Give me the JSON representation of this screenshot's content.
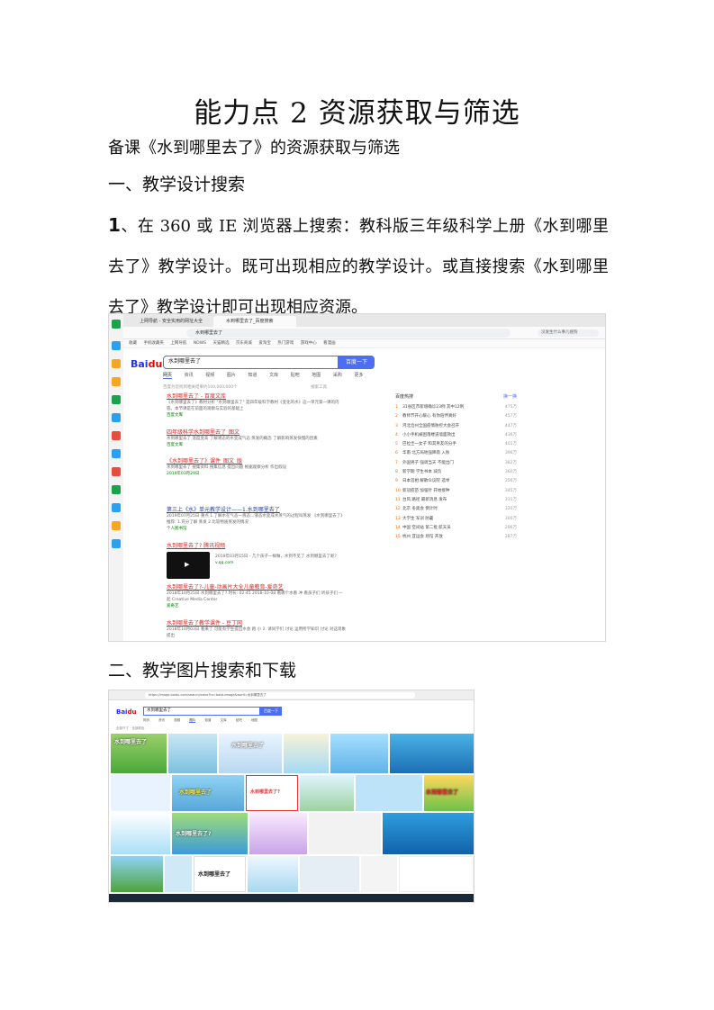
{
  "document": {
    "title": "能力点 2 资源获取与筛选",
    "subtitle": "备课《水到哪里去了》的资源获取与筛选",
    "section1_heading": "一、教学设计搜索",
    "step_number": "1",
    "step_text": "、在 360 或 IE 浏览器上搜索：教科版三年级科学上册《水到哪里去了》教学设计。既可出现相应的教学设计。或直接搜索《水到哪里去了》教学设计即可出现相应资源。",
    "section2_heading": "二、教学图片搜索和下载"
  },
  "screenshot1": {
    "tabs": [
      "上网导航 - 安全实用的网址大全",
      "水到哪里去了_百度搜索"
    ],
    "address": "水到哪里去了",
    "search_hint": "没发生什么事儿搜狗",
    "bookmarks": [
      "收藏",
      "手机收藏夹",
      "上网导航",
      "NOWS",
      "天猫精选",
      "京东商城",
      "爱淘宝",
      "热门游戏",
      "游戏中心",
      "看漫画"
    ],
    "search_query": "水到哪里去了",
    "search_button": "百度一下",
    "nav_tabs": [
      "网页",
      "资讯",
      "视频",
      "图片",
      "知道",
      "文库",
      "贴吧",
      "地图",
      "采购",
      "更多"
    ],
    "result_meta": "百度为您找到相关结果约100,000,000个",
    "search_tools": "搜索工具",
    "results": [
      {
        "title": "水到哪里去了 - 百度文库",
        "desc": "《水到哪里去了》教材分析 \"水到哪里去了\" 是四年级科学教材《变化的水》这一单元第一课的内容。本节课是在前面的观察与实验的基础上",
        "source": "百度文库"
      },
      {
        "title": "四年级科学水到哪里去了_图文",
        "desc": "水到哪里去了 温度变高 了解液态的水变成气态 蒸发的概念 了解影响蒸发快慢的因素",
        "source": "百度文库"
      },
      {
        "title": "《水到哪里去了》课件_图文_版",
        "desc": "水到哪里去了 搜集资料 搜集信息 提出问题 根据观察分析 作出假设",
        "source": "2019年03月29日"
      },
      {
        "title": "第三上《水》单元教学设计——1.水到哪里去了",
        "desc": "2019年07月25日 重点 1.了解水在气态一液态...液态水变成水蒸气的过程叫蒸发 《水到哪里去了》 推荐: 1.充分了解 蒸发 2.比较物质蒸发的情况",
        "source": "个人图书馆"
      },
      {
        "title": "水到哪里去了? 腾讯视频",
        "desc": "2019年03月15日 - 几个孩子一样做，水到不见了 水到哪里去了呢?",
        "source": "v.qq.com"
      },
      {
        "title": "水到哪里去了?-儿童-动画片大全儿童教育-爱奇艺",
        "desc": "2018年10月25日 水到哪里去了? 时长: 02:45 2018-10-08 看哪个水看 冲 看孩子们 听孩子们 一起 Creative Media Center",
        "source": "爱奇艺"
      },
      {
        "title": "水到哪里去了教学课件 - 豆丁网",
        "desc": "2018年10月03日 看来了 可能有学生提出水会 跑 小 2. 请同学们 讨论 运用所学知识 讨论 对这现象提出",
        "source": "豆丁网"
      }
    ],
    "hot_title": "百度热搜",
    "hot_switch": "换一换",
    "hot_list": [
      {
        "rank": "1",
        "text": "31省区市新增确诊23例 其中12例",
        "value": "475万"
      },
      {
        "rank": "2",
        "text": "教师节开心暖心 有你陪伴真好",
        "value": "457万"
      },
      {
        "rank": "3",
        "text": "河北沧州全国疫情防控大会召开",
        "value": "447万"
      },
      {
        "rank": "4",
        "text": "小小手机被困落楼道墙面救出",
        "value": "436万"
      },
      {
        "rank": "5",
        "text": "巴拉圭一女子 和其男友的分手",
        "value": "401万"
      },
      {
        "rank": "6",
        "text": "华南 北方局地强降雨 入秋",
        "value": "396万"
      },
      {
        "rank": "7",
        "text": "外国男子 强调当天 不能出门",
        "value": "382万"
      },
      {
        "rank": "8",
        "text": "新学期 学生书本 减负",
        "value": "360万"
      },
      {
        "rank": "9",
        "text": "日本首相 解散众议院 选举",
        "value": "356万"
      },
      {
        "rank": "10",
        "text": "新冠疫苗 加强针 开始接种",
        "value": "345万"
      },
      {
        "rank": "11",
        "text": "台风 路径 最新消息 发布",
        "value": "331万"
      },
      {
        "rank": "12",
        "text": "北京 冬奥会 倒计时",
        "value": "320万"
      },
      {
        "rank": "13",
        "text": "大学生 军训 防暑",
        "value": "300万"
      },
      {
        "rank": "14",
        "text": "中国 空间站 第二批 航天员",
        "value": "296万"
      },
      {
        "rank": "15",
        "text": "杭州 亚运会 场馆 开放",
        "value": "287万"
      }
    ]
  },
  "screenshot2": {
    "url": "https://image.baidu.com/search/index?tn=baiduimage&word=水到哪里去了",
    "search_query": "水到哪里去了",
    "search_button": "百度一下",
    "tabs": [
      "网页",
      "资讯",
      "视频",
      "图片",
      "知道",
      "文库",
      "贴吧",
      "地图"
    ],
    "filter": "全部尺寸 · 全部颜色",
    "tiles": [
      "水到哪里去了",
      "水到哪里去了",
      "水到哪里去了",
      "水到哪里去了?",
      "水到哪里去了",
      "水到哪里去了?",
      "水到哪里去了"
    ]
  },
  "colors": {
    "baidu_blue": "#4e6ef2",
    "link_red": "#e02020",
    "link_blue": "#2440b3"
  }
}
